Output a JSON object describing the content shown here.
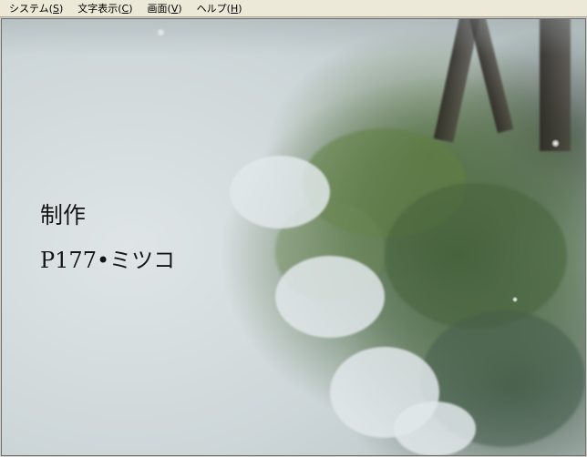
{
  "menu": [
    {
      "label": "システム",
      "key": "S"
    },
    {
      "label": "文字表示",
      "key": "C"
    },
    {
      "label": "画面",
      "key": "V"
    },
    {
      "label": "ヘルプ",
      "key": "H"
    }
  ],
  "credits": {
    "heading": "制作",
    "name": "P177•ミツコ"
  }
}
